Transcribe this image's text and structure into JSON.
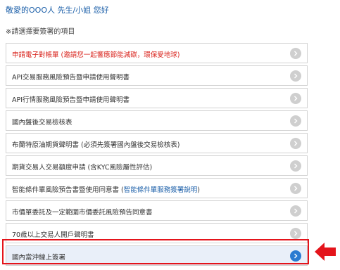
{
  "header": {
    "greeting": "敬愛的OOO人 先生/小姐 您好",
    "instruction": "※請選擇要簽署的項目"
  },
  "items": [
    {
      "label": "申請電子對帳單 (邀請您一起響應節能減碳，環保愛地球)",
      "link": ""
    },
    {
      "label": "API交易服務風險預告暨申請使用聲明書",
      "link": ""
    },
    {
      "label": "API行情服務風險預告暨申請使用聲明書",
      "link": ""
    },
    {
      "label": "國內盤後交易檢核表",
      "link": ""
    },
    {
      "label": "布蘭特原油期貨聲明書 (必須先簽署國內盤後交易檢核表)",
      "link": ""
    },
    {
      "label": "期貨交易人交易額度申請 (含KYC風險屬性評估)",
      "link": ""
    },
    {
      "label": "智能條件單風險預告書暨使用同意書 (",
      "link": "智能條件單服務簽署說明"
    },
    {
      "label": "市價單委託及一定範圍市價委託風險預告同意書",
      "link": ""
    },
    {
      "label": "70歲以上交易人開戶聲明書",
      "link": ""
    },
    {
      "label": "國內當沖線上簽署",
      "link": ""
    }
  ],
  "link_suffix": ")",
  "colors": {
    "highlight": "#e4141b",
    "accent": "#2b7bd1",
    "red_text": "#d9231c"
  },
  "icons": {
    "chevron": "chevron-right-icon",
    "pointer": "arrow-left-icon"
  }
}
